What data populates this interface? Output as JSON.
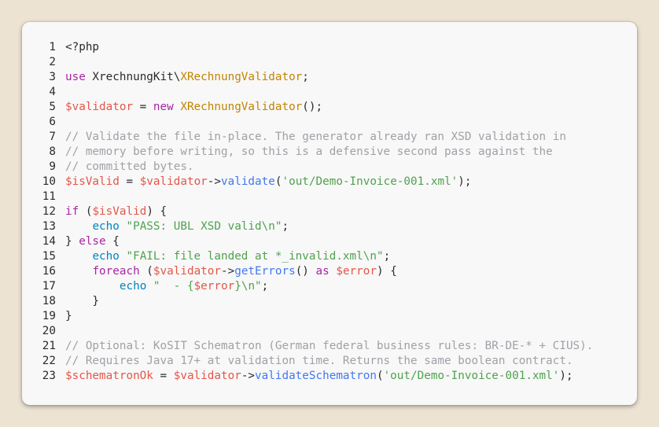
{
  "colors": {
    "background": "#ece3d3",
    "card": "#f8f8f8",
    "text": "#2b2b2b",
    "keyword": "#a626a4",
    "class": "#c18401",
    "variable": "#e45649",
    "string": "#50a14f",
    "comment": "#a0a1a7",
    "function": "#4078f2",
    "builtin": "#0184bc"
  },
  "code": {
    "language": "php",
    "lines": [
      {
        "n": "1",
        "tokens": [
          {
            "t": "<?php",
            "k": "pl"
          }
        ]
      },
      {
        "n": "2",
        "tokens": []
      },
      {
        "n": "3",
        "tokens": [
          {
            "t": "use",
            "k": "kw"
          },
          {
            "t": " XrechnungKit\\",
            "k": "pl"
          },
          {
            "t": "XRechnungValidator",
            "k": "cls"
          },
          {
            "t": ";",
            "k": "pl"
          }
        ]
      },
      {
        "n": "4",
        "tokens": []
      },
      {
        "n": "5",
        "tokens": [
          {
            "t": "$validator",
            "k": "var"
          },
          {
            "t": " = ",
            "k": "pl"
          },
          {
            "t": "new",
            "k": "kw"
          },
          {
            "t": " ",
            "k": "pl"
          },
          {
            "t": "XRechnungValidator",
            "k": "cls"
          },
          {
            "t": "();",
            "k": "pl"
          }
        ]
      },
      {
        "n": "6",
        "tokens": []
      },
      {
        "n": "7",
        "tokens": [
          {
            "t": "// Validate the file in-place. The generator already ran XSD validation in",
            "k": "cm"
          }
        ]
      },
      {
        "n": "8",
        "tokens": [
          {
            "t": "// memory before writing, so this is a defensive second pass against the",
            "k": "cm"
          }
        ]
      },
      {
        "n": "9",
        "tokens": [
          {
            "t": "// committed bytes.",
            "k": "cm"
          }
        ]
      },
      {
        "n": "10",
        "tokens": [
          {
            "t": "$isValid",
            "k": "var"
          },
          {
            "t": " = ",
            "k": "pl"
          },
          {
            "t": "$validator",
            "k": "var"
          },
          {
            "t": "->",
            "k": "pl"
          },
          {
            "t": "validate",
            "k": "fn"
          },
          {
            "t": "(",
            "k": "pl"
          },
          {
            "t": "'out/Demo-Invoice-001.xml'",
            "k": "str"
          },
          {
            "t": ");",
            "k": "pl"
          }
        ]
      },
      {
        "n": "11",
        "tokens": []
      },
      {
        "n": "12",
        "tokens": [
          {
            "t": "if",
            "k": "kw"
          },
          {
            "t": " (",
            "k": "pl"
          },
          {
            "t": "$isValid",
            "k": "var"
          },
          {
            "t": ") {",
            "k": "pl"
          }
        ]
      },
      {
        "n": "13",
        "tokens": [
          {
            "t": "    ",
            "k": "pl"
          },
          {
            "t": "echo",
            "k": "ech"
          },
          {
            "t": " ",
            "k": "pl"
          },
          {
            "t": "\"PASS: UBL XSD valid\\n\"",
            "k": "str"
          },
          {
            "t": ";",
            "k": "pl"
          }
        ]
      },
      {
        "n": "14",
        "tokens": [
          {
            "t": "} ",
            "k": "pl"
          },
          {
            "t": "else",
            "k": "kw"
          },
          {
            "t": " {",
            "k": "pl"
          }
        ]
      },
      {
        "n": "15",
        "tokens": [
          {
            "t": "    ",
            "k": "pl"
          },
          {
            "t": "echo",
            "k": "ech"
          },
          {
            "t": " ",
            "k": "pl"
          },
          {
            "t": "\"FAIL: file landed at *_invalid.xml\\n\"",
            "k": "str"
          },
          {
            "t": ";",
            "k": "pl"
          }
        ]
      },
      {
        "n": "16",
        "tokens": [
          {
            "t": "    ",
            "k": "pl"
          },
          {
            "t": "foreach",
            "k": "kw"
          },
          {
            "t": " (",
            "k": "pl"
          },
          {
            "t": "$validator",
            "k": "var"
          },
          {
            "t": "->",
            "k": "pl"
          },
          {
            "t": "getErrors",
            "k": "fn"
          },
          {
            "t": "() ",
            "k": "pl"
          },
          {
            "t": "as",
            "k": "kw"
          },
          {
            "t": " ",
            "k": "pl"
          },
          {
            "t": "$error",
            "k": "var"
          },
          {
            "t": ") {",
            "k": "pl"
          }
        ]
      },
      {
        "n": "17",
        "tokens": [
          {
            "t": "        ",
            "k": "pl"
          },
          {
            "t": "echo",
            "k": "ech"
          },
          {
            "t": " ",
            "k": "pl"
          },
          {
            "t": "\"  - {",
            "k": "str"
          },
          {
            "t": "$error",
            "k": "var"
          },
          {
            "t": "}\\n\"",
            "k": "str"
          },
          {
            "t": ";",
            "k": "pl"
          }
        ]
      },
      {
        "n": "18",
        "tokens": [
          {
            "t": "    }",
            "k": "pl"
          }
        ]
      },
      {
        "n": "19",
        "tokens": [
          {
            "t": "}",
            "k": "pl"
          }
        ]
      },
      {
        "n": "20",
        "tokens": []
      },
      {
        "n": "21",
        "tokens": [
          {
            "t": "// Optional: KoSIT Schematron (German federal business rules: BR-DE-* + CIUS).",
            "k": "cm"
          }
        ]
      },
      {
        "n": "22",
        "tokens": [
          {
            "t": "// Requires Java 17+ at validation time. Returns the same boolean contract.",
            "k": "cm"
          }
        ]
      },
      {
        "n": "23",
        "tokens": [
          {
            "t": "$schematronOk",
            "k": "var"
          },
          {
            "t": " = ",
            "k": "pl"
          },
          {
            "t": "$validator",
            "k": "var"
          },
          {
            "t": "->",
            "k": "pl"
          },
          {
            "t": "validateSchematron",
            "k": "fn"
          },
          {
            "t": "(",
            "k": "pl"
          },
          {
            "t": "'out/Demo-Invoice-001.xml'",
            "k": "str"
          },
          {
            "t": ");",
            "k": "pl"
          }
        ]
      }
    ]
  }
}
